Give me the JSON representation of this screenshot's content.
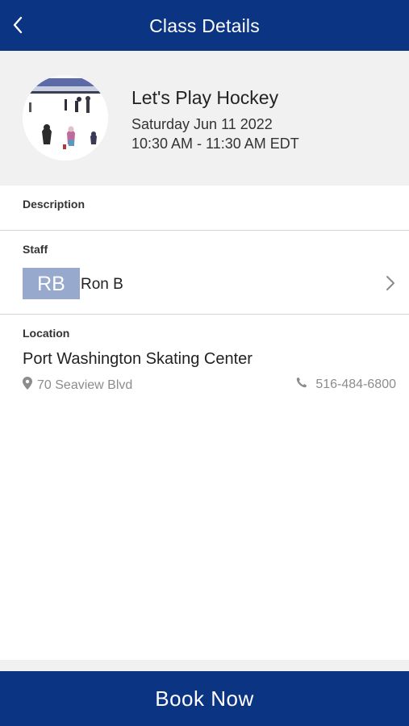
{
  "header": {
    "title": "Class Details",
    "back_icon": "chevron-left-icon"
  },
  "class_info": {
    "name": "Let's Play Hockey",
    "date": "Saturday Jun 11 2022",
    "time": "10:30 AM - 11:30 AM EDT",
    "image": "ice-rink-thumbnail"
  },
  "description": {
    "label": "Description"
  },
  "staff": {
    "label": "Staff",
    "initials": "RB",
    "name": "Ron B",
    "chevron_icon": "chevron-right-icon"
  },
  "location": {
    "label": "Location",
    "name": "Port Washington Skating Center",
    "address": "70 Seaview Blvd",
    "address_icon": "map-pin-icon",
    "phone": "516-484-6800",
    "phone_icon": "phone-icon"
  },
  "footer": {
    "book_label": "Book Now"
  },
  "colors": {
    "brand": "#0b3482",
    "initials_bg": "#97a9cc",
    "hero_bg": "#f1f1f1",
    "muted_text": "#8c8c8c"
  }
}
